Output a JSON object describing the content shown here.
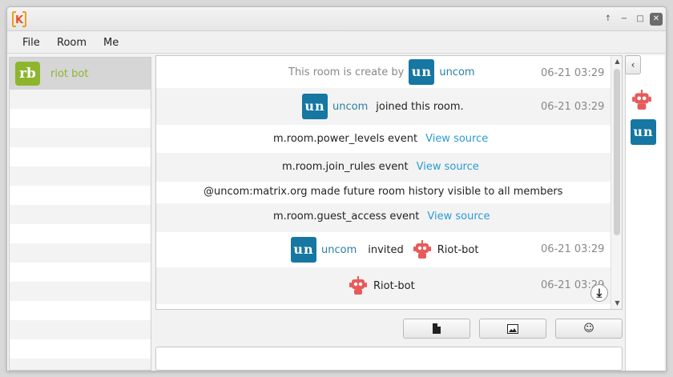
{
  "window": {
    "logo_letter": "K",
    "controls": [
      "↑",
      "−",
      "□",
      "✕"
    ]
  },
  "menu": {
    "file": "File",
    "room": "Room",
    "me": "Me"
  },
  "sidebar": {
    "rooms": [
      {
        "avatar_initials": "rb",
        "name": "riot bot",
        "avatar_color": "#8db62e"
      }
    ]
  },
  "timeline": {
    "events": [
      {
        "prefix": "This room is create by",
        "user_initials": "un",
        "user": "uncom",
        "time": "06-21 03:29"
      },
      {
        "user_initials": "un",
        "user": "uncom",
        "text": "joined this room.",
        "time": "06-21 03:29"
      },
      {
        "text": "m.room.power_levels event",
        "link": "View source"
      },
      {
        "text": "m.room.join_rules event",
        "link": "View source"
      },
      {
        "text": "@uncom:matrix.org made future room history visible to all members"
      },
      {
        "text": "m.room.guest_access event",
        "link": "View source"
      },
      {
        "user_initials": "un",
        "user": "uncom",
        "text": "invited",
        "target": "Riot-bot",
        "time": "06-21 03:29"
      },
      {
        "user": "Riot-bot",
        "time": "06-21 03:29"
      }
    ],
    "jump_label": "⤓"
  },
  "toolbar": {
    "file_icon": "file-icon",
    "image_icon": "image-icon",
    "emoji_label": "☺"
  },
  "members": {
    "collapse_label": "‹",
    "user_initials": "un"
  },
  "colors": {
    "accent_green": "#8db62e",
    "avatar_blue": "#1577a2",
    "link_blue": "#2a9bd3"
  }
}
